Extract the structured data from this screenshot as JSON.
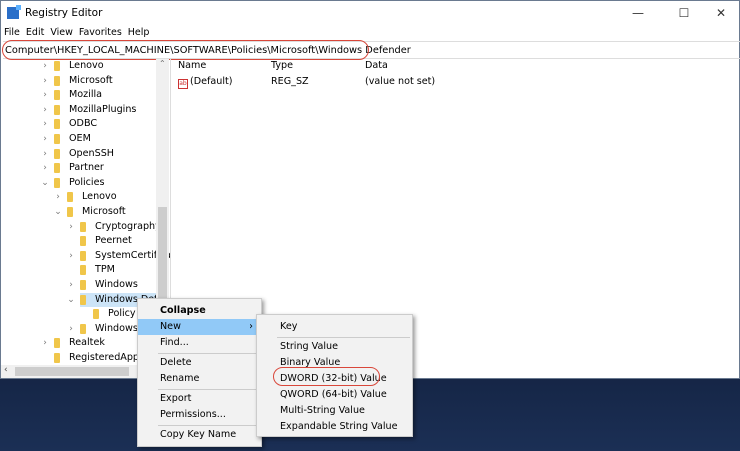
{
  "window": {
    "title": "Registry Editor",
    "minimize": "—",
    "maximize": "☐",
    "close": "✕"
  },
  "menubar": [
    "File",
    "Edit",
    "View",
    "Favorites",
    "Help"
  ],
  "address": "Computer\\HKEY_LOCAL_MACHINE\\SOFTWARE\\Policies\\Microsoft\\Windows Defender",
  "tree": [
    {
      "label": "Lenovo",
      "level": 0,
      "state": "collapsed"
    },
    {
      "label": "Microsoft",
      "level": 0,
      "state": "collapsed"
    },
    {
      "label": "Mozilla",
      "level": 0,
      "state": "collapsed"
    },
    {
      "label": "MozillaPlugins",
      "level": 0,
      "state": "collapsed"
    },
    {
      "label": "ODBC",
      "level": 0,
      "state": "collapsed"
    },
    {
      "label": "OEM",
      "level": 0,
      "state": "collapsed"
    },
    {
      "label": "OpenSSH",
      "level": 0,
      "state": "collapsed"
    },
    {
      "label": "Partner",
      "level": 0,
      "state": "collapsed"
    },
    {
      "label": "Policies",
      "level": 0,
      "state": "expanded"
    },
    {
      "label": "Lenovo",
      "level": 1,
      "state": "collapsed"
    },
    {
      "label": "Microsoft",
      "level": 1,
      "state": "expanded"
    },
    {
      "label": "Cryptography",
      "level": 2,
      "state": "collapsed"
    },
    {
      "label": "Peernet",
      "level": 2,
      "state": "leaf"
    },
    {
      "label": "SystemCertifica",
      "level": 2,
      "state": "collapsed"
    },
    {
      "label": "TPM",
      "level": 2,
      "state": "leaf"
    },
    {
      "label": "Windows",
      "level": 2,
      "state": "collapsed"
    },
    {
      "label": "Windows Defe",
      "level": 2,
      "state": "expanded",
      "selected": true
    },
    {
      "label": "Policy M",
      "level": 3,
      "state": "leaf"
    },
    {
      "label": "Windows N",
      "level": 2,
      "state": "collapsed"
    },
    {
      "label": "Realtek",
      "level": 0,
      "state": "collapsed"
    },
    {
      "label": "RegisteredApplic",
      "level": 0,
      "state": "leaf"
    }
  ],
  "list": {
    "headers": [
      "Name",
      "Type",
      "Data"
    ],
    "rows": [
      {
        "name": "(Default)",
        "type": "REG_SZ",
        "data": "(value not set)",
        "icon": "ab"
      }
    ]
  },
  "context_menu": [
    {
      "label": "Collapse",
      "bold": true
    },
    {
      "label": "New",
      "highlight": true,
      "submenu": true
    },
    {
      "label": "Find..."
    },
    {
      "sep": true
    },
    {
      "label": "Delete"
    },
    {
      "label": "Rename"
    },
    {
      "sep": true
    },
    {
      "label": "Export"
    },
    {
      "label": "Permissions..."
    },
    {
      "sep": true
    },
    {
      "label": "Copy Key Name"
    }
  ],
  "submenu": [
    {
      "label": "Key"
    },
    {
      "sep": true
    },
    {
      "label": "String Value"
    },
    {
      "label": "Binary Value"
    },
    {
      "label": "DWORD (32-bit) Value",
      "annotated": true
    },
    {
      "label": "QWORD (64-bit) Value"
    },
    {
      "label": "Multi-String Value"
    },
    {
      "label": "Expandable String Value"
    }
  ],
  "colors": {
    "annotation": "#d9473a",
    "highlight": "#91c9f7",
    "folder": "#f0c64a"
  }
}
